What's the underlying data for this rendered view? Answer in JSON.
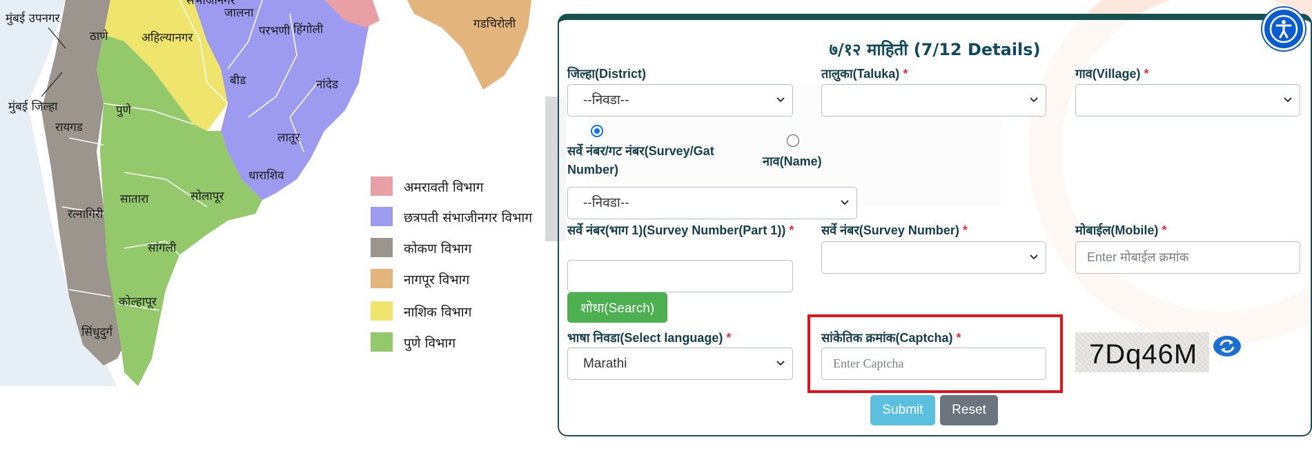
{
  "map": {
    "district_labels": [
      "मुंबई उपनगर",
      "ठाणे",
      "मुंबई जिल्हा",
      "रायगड",
      "पुणे",
      "अहिल्यानगर",
      "संभाजीनगर",
      "जालना",
      "परभणी",
      "हिंगोली",
      "बीड",
      "नांदेड",
      "लातूर",
      "धाराशिव",
      "सातारा",
      "सोलापूर",
      "सांगली",
      "कोल्हापूर",
      "रत्नागिरी",
      "सिंधुदुर्ग",
      "गडचिरोली"
    ],
    "legend": [
      {
        "label": "अमरावती विभाग",
        "color": "#e8a0a4"
      },
      {
        "label": "छत्रपती संभाजीनगर विभाग",
        "color": "#9d9bf0"
      },
      {
        "label": "कोकण विभाग",
        "color": "#9c958e"
      },
      {
        "label": "नागपूर विभाग",
        "color": "#e3b57d"
      },
      {
        "label": "नाशिक विभाग",
        "color": "#efe46c"
      },
      {
        "label": "पुणे विभाग",
        "color": "#94c96b"
      }
    ]
  },
  "form": {
    "title": "७/१२ माहिती (7/12 Details)",
    "district": {
      "label": "जिल्हा(District)",
      "value": "--निवडा--"
    },
    "taluka": {
      "label": "तालुका(Taluka)",
      "required": "*",
      "value": ""
    },
    "village": {
      "label": "गाव(Village)",
      "required": "*",
      "value": ""
    },
    "search_by": {
      "survey_label": "सर्वे नंबर/गट नंबर(Survey/Gat Number)",
      "name_label": "नाव(Name)",
      "selected": "survey"
    },
    "search_type_select": {
      "value": "--निवडा--"
    },
    "survey_part1": {
      "label": "सर्वे नंबर(भाग 1)(Survey Number(Part 1))",
      "required": "*",
      "value": ""
    },
    "survey_number": {
      "label": "सर्वे नंबर(Survey Number)",
      "required": "*",
      "value": ""
    },
    "mobile": {
      "label": "मोबाईल(Mobile)",
      "required": "*",
      "placeholder": "Enter मोबाईल क्रमांक"
    },
    "search_button": "शोधा(Search)",
    "language": {
      "label": "भाषा निवडा(Select language)",
      "required": "*",
      "value": "Marathi"
    },
    "captcha": {
      "label": "सांकेतिक क्रमांक(Captcha)",
      "required": "*",
      "placeholder": "Enter Captcha",
      "image_text": "7Dq46M"
    },
    "submit_button": "Submit",
    "reset_button": "Reset"
  }
}
